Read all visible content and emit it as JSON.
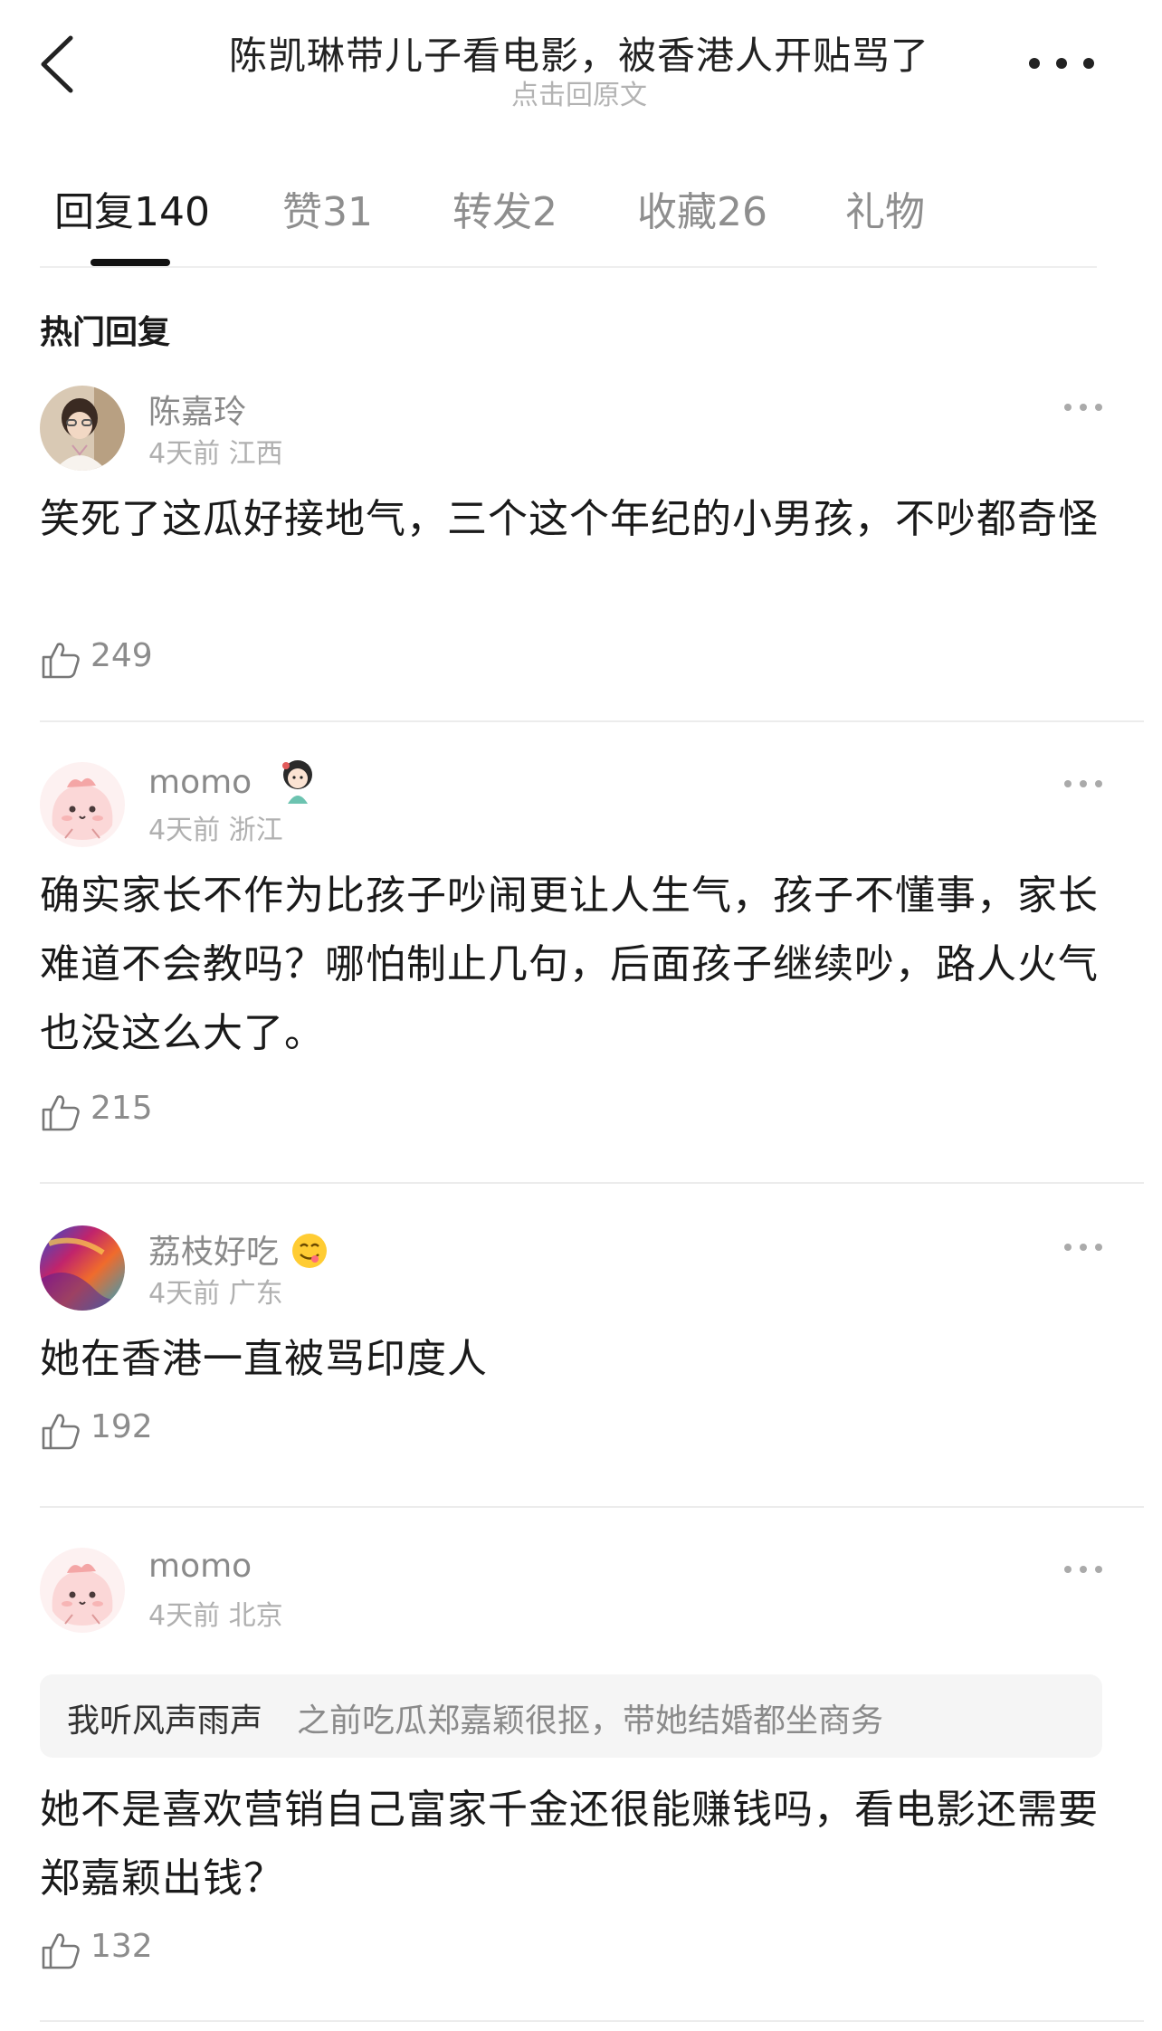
{
  "header": {
    "title": "陈凯琳带儿子看电影，被香港人开贴骂了",
    "subtitle": "点击回原文"
  },
  "tabs": [
    {
      "label": "回复140"
    },
    {
      "label": "赞31"
    },
    {
      "label": "转发2"
    },
    {
      "label": "收藏26"
    },
    {
      "label": "礼物"
    }
  ],
  "section": {
    "title": "热门回复"
  },
  "comments": [
    {
      "name": "陈嘉玲",
      "meta": "4天前 江西",
      "text": "笑死了这瓜好接地气，三个这个年纪的小男孩，不吵都奇怪",
      "likes": "249"
    },
    {
      "name": "momo",
      "meta": "4天前 浙江",
      "text": "确实家长不作为比孩子吵闹更让人生气，孩子不懂事，家长难道不会教吗？哪怕制止几句，后面孩子继续吵，路人火气也没这么大了。",
      "likes": "215"
    },
    {
      "name": "荔枝好吃",
      "meta": "4天前 广东",
      "text": "她在香港一直被骂印度人",
      "likes": "192"
    },
    {
      "name": "momo",
      "meta": "4天前 北京",
      "quote_author": "我听风声雨声",
      "quote_text": "之前吃瓜郑嘉颖很抠，带她结婚都坐商务",
      "text": "她不是喜欢营销自己富家千金还很能赚钱吗，看电影还需要郑嘉颖出钱？",
      "likes": "132"
    }
  ]
}
